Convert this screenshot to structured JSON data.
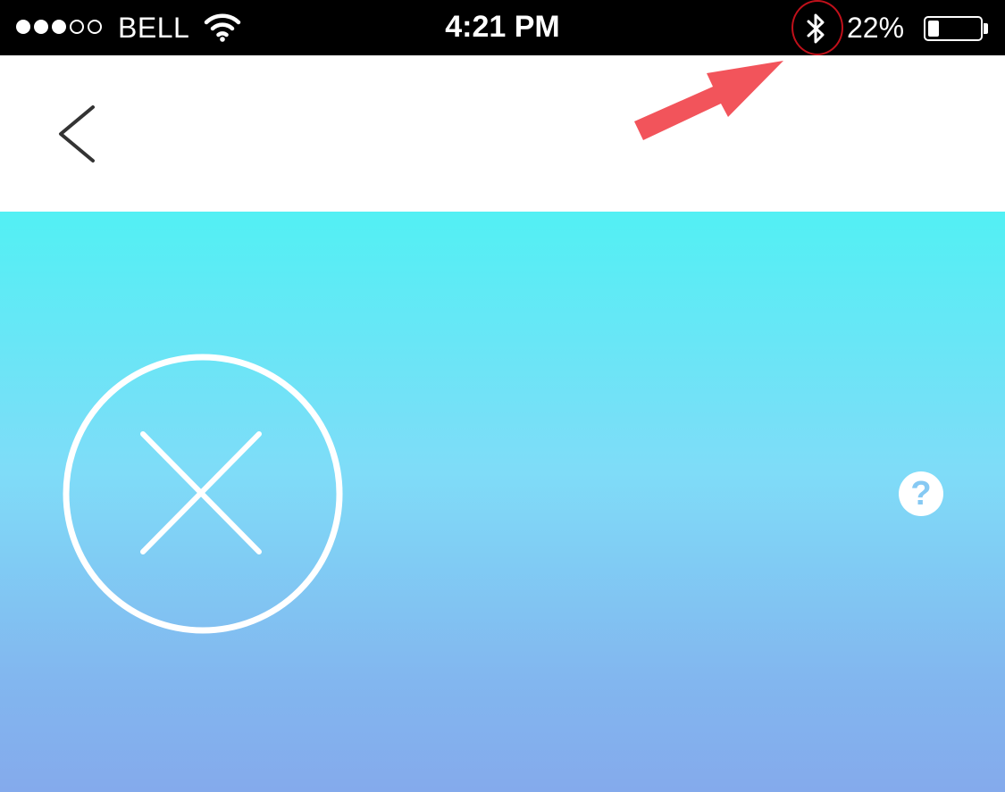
{
  "status_bar": {
    "signal_bars_filled": 3,
    "signal_bars_total": 5,
    "carrier": "BELL",
    "wifi_icon": "wifi-icon",
    "time": "4:21 PM",
    "bluetooth_icon": "bluetooth-icon",
    "battery_percent_text": "22%",
    "battery_level": 0.22
  },
  "annotation": {
    "arrow_color": "#f2545b",
    "highlight_color": "#c0101a"
  },
  "nav_bar": {
    "back_icon": "chevron-left-icon"
  },
  "content": {
    "gradient_top": "#52f0f4",
    "gradient_bottom": "#84aaec",
    "status_icon": "circle-x-icon",
    "help_icon": "question-mark-icon",
    "help_glyph": "?"
  }
}
